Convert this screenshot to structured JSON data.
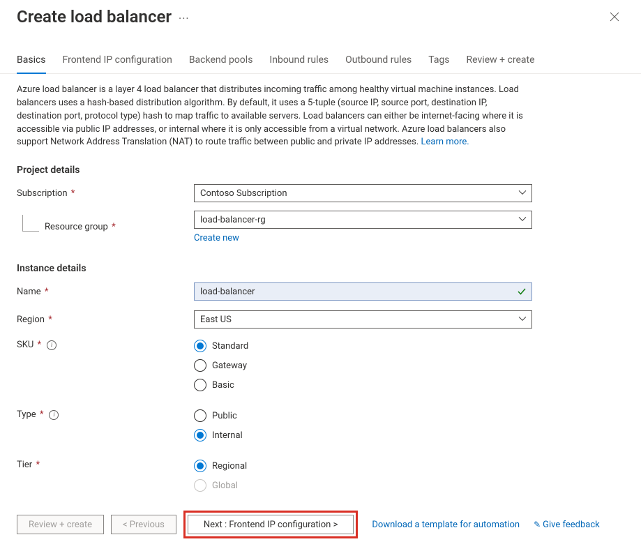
{
  "header": {
    "title": "Create load balancer"
  },
  "tabs": [
    {
      "label": "Basics",
      "active": true
    },
    {
      "label": "Frontend IP configuration",
      "active": false
    },
    {
      "label": "Backend pools",
      "active": false
    },
    {
      "label": "Inbound rules",
      "active": false
    },
    {
      "label": "Outbound rules",
      "active": false
    },
    {
      "label": "Tags",
      "active": false
    },
    {
      "label": "Review + create",
      "active": false
    }
  ],
  "description": {
    "text": "Azure load balancer is a layer 4 load balancer that distributes incoming traffic among healthy virtual machine instances. Load balancers uses a hash-based distribution algorithm. By default, it uses a 5-tuple (source IP, source port, destination IP, destination port, protocol type) hash to map traffic to available servers. Load balancers can either be internet-facing where it is accessible via public IP addresses, or internal where it is only accessible from a virtual network. Azure load balancers also support Network Address Translation (NAT) to route traffic between public and private IP addresses.  ",
    "link": "Learn more."
  },
  "project_details": {
    "heading": "Project details",
    "subscription": {
      "label": "Subscription",
      "value": "Contoso Subscription"
    },
    "resource_group": {
      "label": "Resource group",
      "value": "load-balancer-rg",
      "create_link": "Create new"
    }
  },
  "instance_details": {
    "heading": "Instance details",
    "name": {
      "label": "Name",
      "value": "load-balancer"
    },
    "region": {
      "label": "Region",
      "value": "East US"
    },
    "sku": {
      "label": "SKU",
      "options": [
        {
          "label": "Standard",
          "checked": true
        },
        {
          "label": "Gateway",
          "checked": false
        },
        {
          "label": "Basic",
          "checked": false
        }
      ]
    },
    "type": {
      "label": "Type",
      "options": [
        {
          "label": "Public",
          "checked": false
        },
        {
          "label": "Internal",
          "checked": true
        }
      ]
    },
    "tier": {
      "label": "Tier",
      "options": [
        {
          "label": "Regional",
          "checked": true,
          "disabled": false
        },
        {
          "label": "Global",
          "checked": false,
          "disabled": true
        }
      ]
    }
  },
  "footer": {
    "review": "Review + create",
    "previous": "< Previous",
    "next": "Next : Frontend IP configuration >",
    "download_link": "Download a template for automation",
    "feedback_link": "Give feedback"
  }
}
